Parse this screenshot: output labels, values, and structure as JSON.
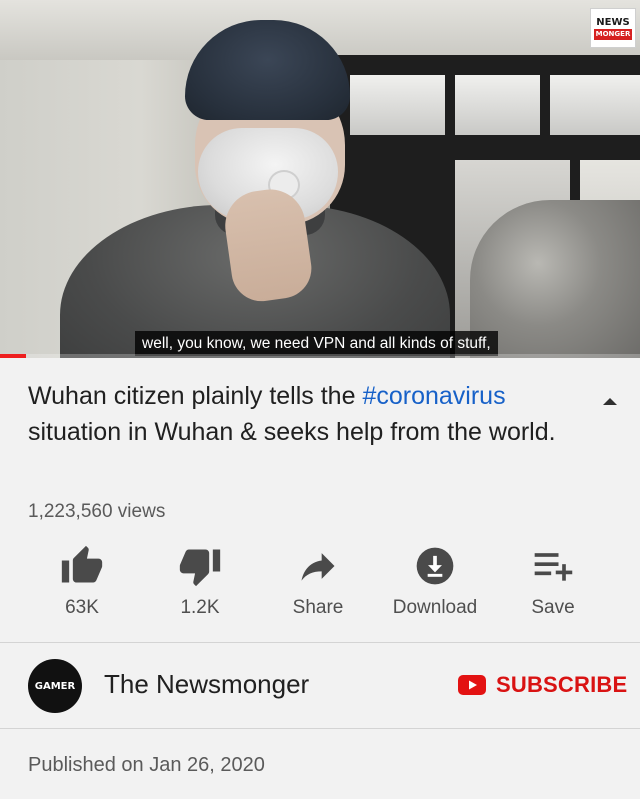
{
  "player": {
    "caption": "well, you know, we need VPN and all kinds of stuff,",
    "progress_fraction": 0.04,
    "watermark_top": "NEWS",
    "watermark_bottom": "MONGER"
  },
  "video": {
    "title_before": "Wuhan citizen plainly tells the ",
    "title_hashtag": "#coronavirus",
    "title_after": " situation in Wuhan & seeks help from the world.",
    "views": "1,223,560 views"
  },
  "actions": {
    "like": {
      "label": "63K",
      "icon": "thumbs-up-icon"
    },
    "dislike": {
      "label": "1.2K",
      "icon": "thumbs-down-icon"
    },
    "share": {
      "label": "Share",
      "icon": "share-arrow-icon"
    },
    "download": {
      "label": "Download",
      "icon": "download-circle-icon"
    },
    "save": {
      "label": "Save",
      "icon": "playlist-add-icon"
    }
  },
  "channel": {
    "avatar_text": "GAMER",
    "name": "The Newsmonger",
    "subscribe_label": "SUBSCRIBE"
  },
  "published": "Published on Jan 26, 2020",
  "colors": {
    "accent_red": "#d91313",
    "link_blue": "#1761c8",
    "background": "#f2f2f2"
  }
}
